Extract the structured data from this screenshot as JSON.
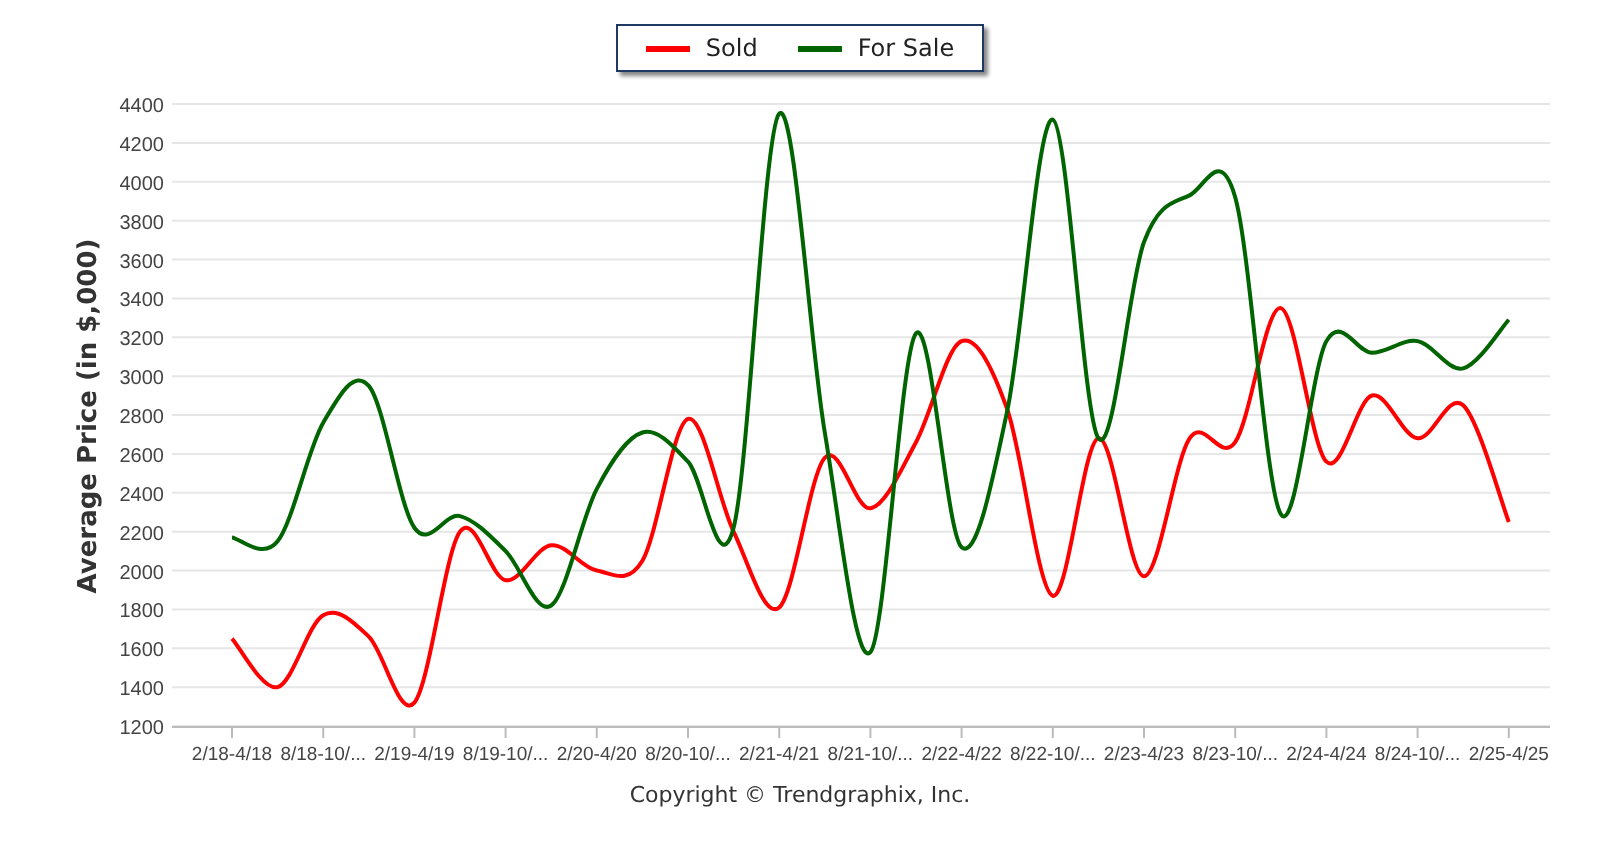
{
  "chart": {
    "chart_data": {
      "type": "line",
      "ylabel": "Average Price (in $,000)",
      "categories": [
        "2/18-4/18",
        null,
        "8/18-10/...",
        null,
        "2/19-4/19",
        null,
        "8/19-10/...",
        null,
        "2/20-4/20",
        null,
        "8/20-10/...",
        null,
        "2/21-4/21",
        null,
        "8/21-10/...",
        null,
        "2/22-4/22",
        null,
        "8/22-10/...",
        null,
        "2/23-4/23",
        null,
        "8/23-10/...",
        null,
        "2/24-4/24",
        null,
        "8/24-10/...",
        null,
        "2/25-4/25"
      ],
      "ylim": [
        1200,
        4400
      ],
      "grid": true,
      "yticks": [
        1200,
        1400,
        1600,
        1800,
        2000,
        2200,
        2400,
        2600,
        2800,
        3000,
        3200,
        3400,
        3600,
        3800,
        4000,
        4200,
        4400
      ],
      "series": [
        {
          "name": "Sold",
          "color": "#ff0000",
          "values": [
            1650,
            1400,
            1770,
            1660,
            1320,
            2200,
            1950,
            2130,
            2000,
            2050,
            2780,
            2200,
            1810,
            2580,
            2320,
            2660,
            3180,
            2830,
            1870,
            2680,
            1970,
            2680,
            2660,
            3350,
            2560,
            2900,
            2680,
            2850,
            2250
          ]
        },
        {
          "name": "For Sale",
          "color": "#006400",
          "values": [
            2170,
            2150,
            2760,
            2950,
            2220,
            2280,
            2100,
            1820,
            2420,
            2710,
            2560,
            2220,
            4350,
            2710,
            1580,
            3220,
            2120,
            2820,
            4320,
            2680,
            3690,
            3930,
            3920,
            2290,
            3180,
            3120,
            3180,
            3040,
            3290
          ]
        }
      ]
    },
    "footer": "Copyright © Trendgraphix, Inc."
  }
}
